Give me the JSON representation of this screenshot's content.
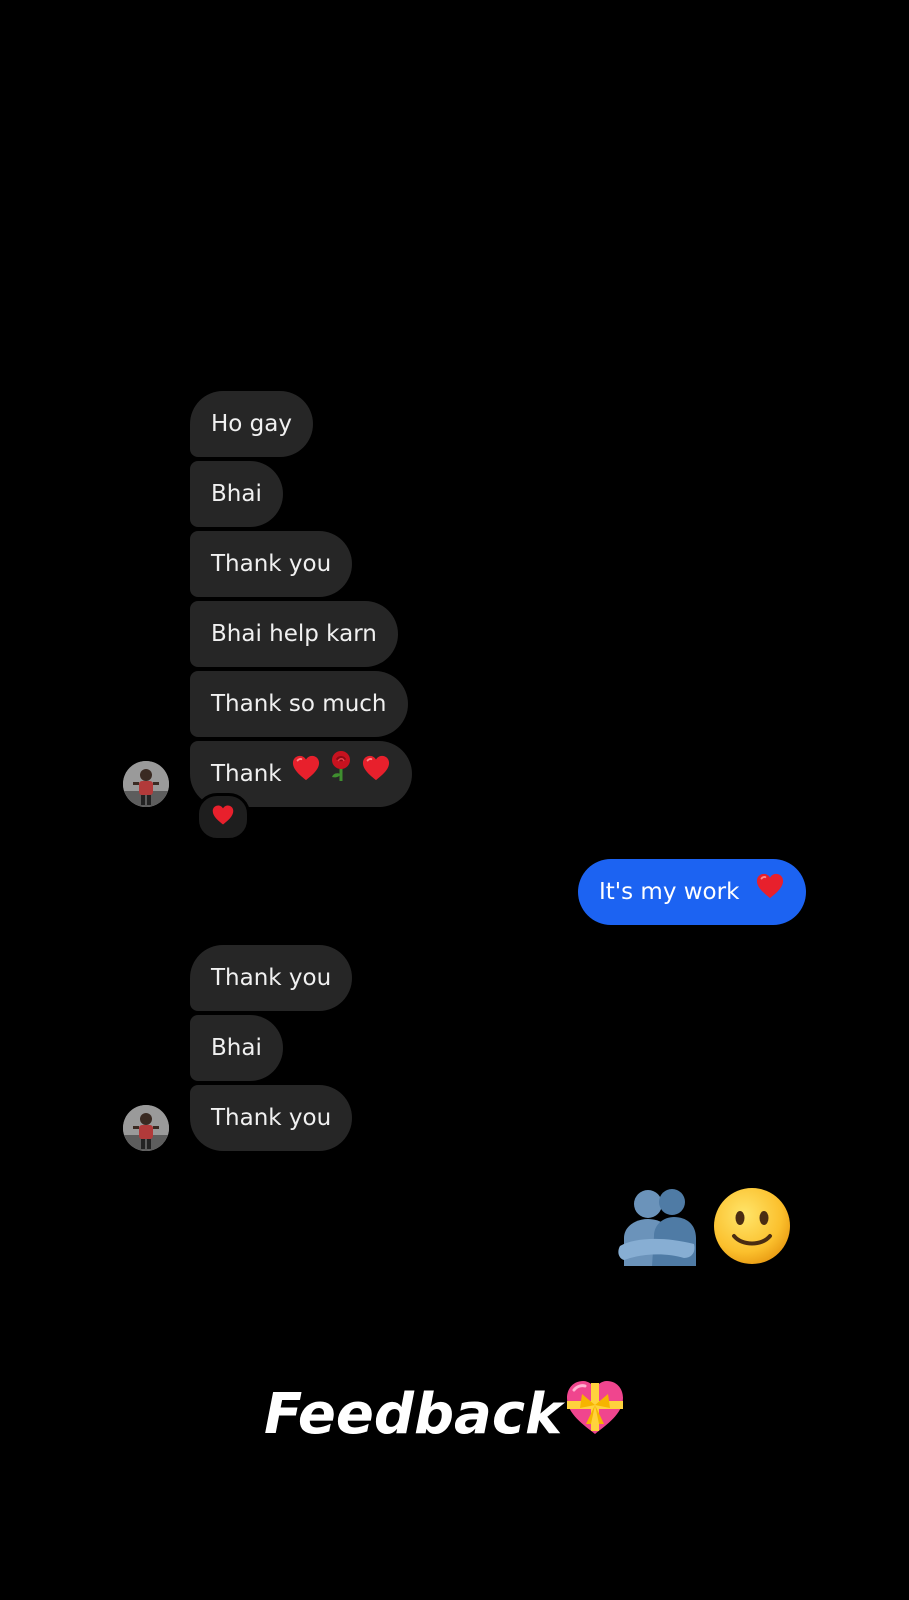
{
  "thread": {
    "group1": [
      {
        "text": "Ho gay"
      },
      {
        "text": "Bhai"
      },
      {
        "text": "Thank you"
      },
      {
        "text": "Bhai help karn"
      },
      {
        "text": "Thank so much"
      },
      {
        "text": "Thank"
      }
    ],
    "group1_last_emojis": [
      "heart-icon",
      "rose-icon",
      "heart-icon"
    ],
    "reaction": "heart-icon",
    "outgoing": {
      "text": "It's my work"
    },
    "group2": [
      {
        "text": "Thank you"
      },
      {
        "text": "Bhai"
      },
      {
        "text": "Thank you"
      }
    ],
    "outgoing_emojis": [
      "people-hugging-icon",
      "slightly-smiling-face-icon"
    ]
  },
  "caption": {
    "text": "Feedback",
    "emoji": "heart-with-ribbon-icon"
  },
  "colors": {
    "background": "#000000",
    "incoming_bubble": "#262626",
    "outgoing_bubble": "#1c63f2",
    "heart": "#e8202c"
  }
}
